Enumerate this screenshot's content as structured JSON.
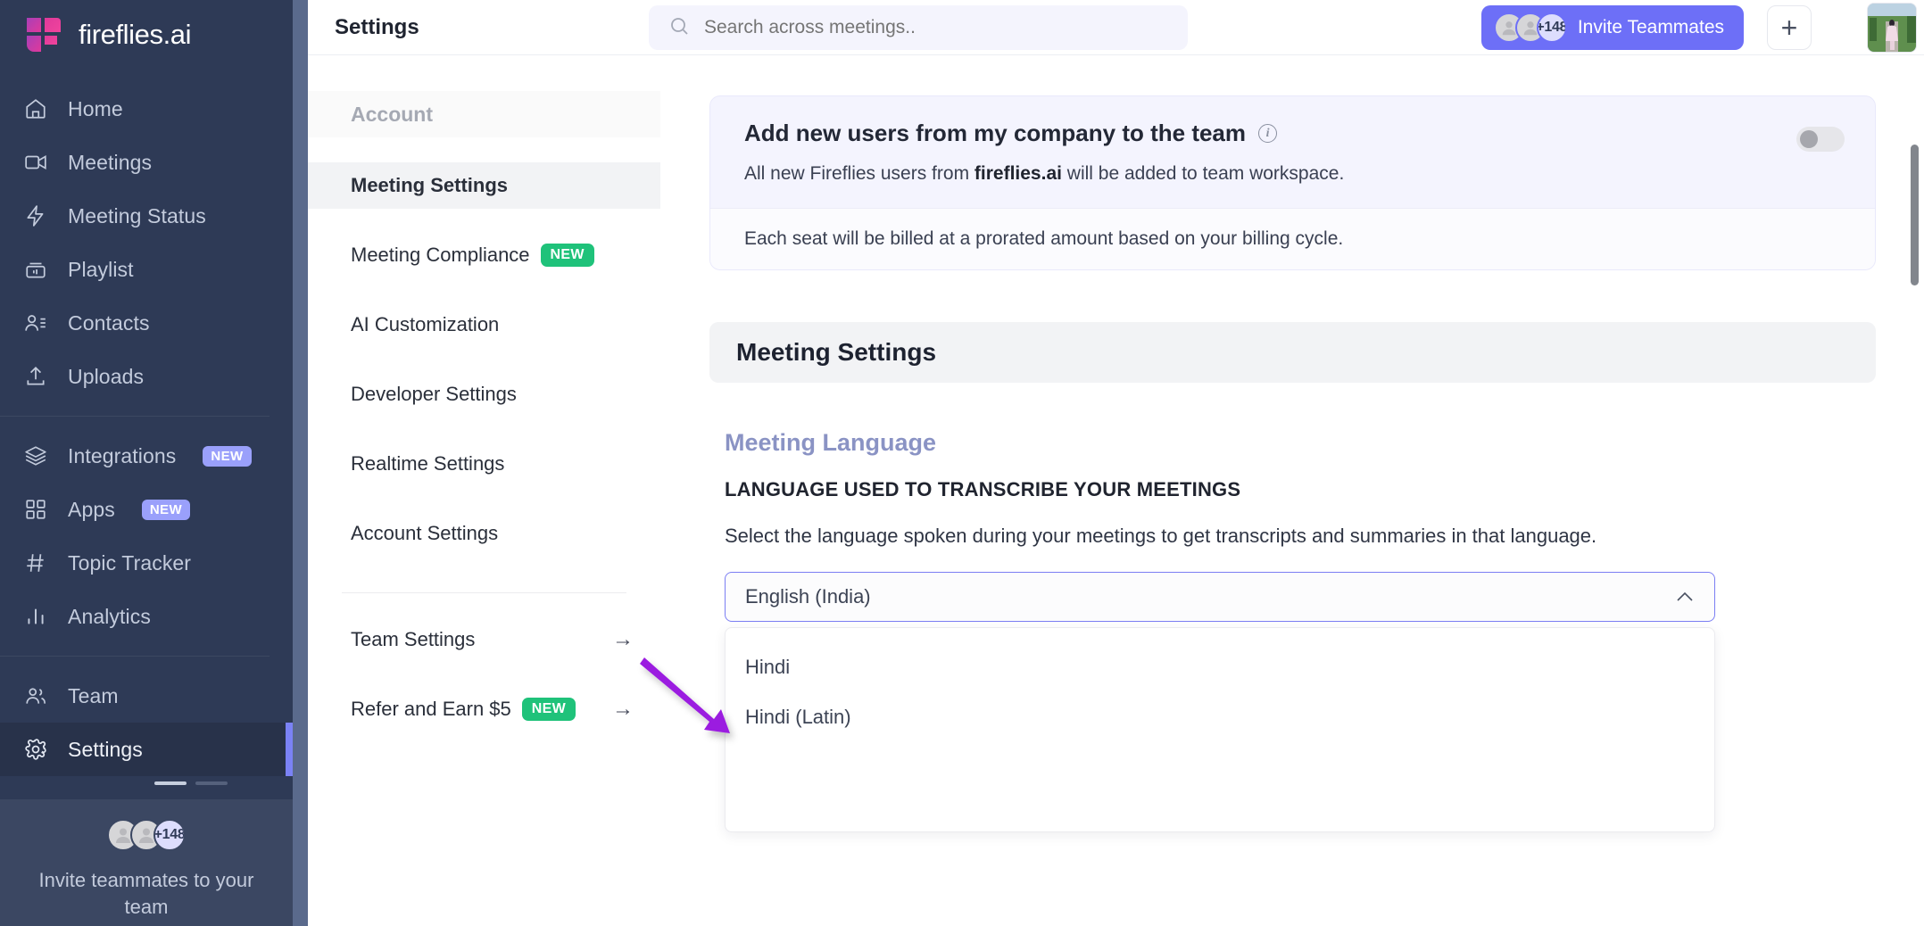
{
  "brand": {
    "name": "fireflies.ai",
    "logo_icon": "fireflies-logo-icon",
    "logo_color": "#e0399b"
  },
  "sidebar": {
    "items": [
      {
        "label": "Home",
        "icon": "home-icon",
        "badge": null,
        "active": false
      },
      {
        "label": "Meetings",
        "icon": "video-camera-icon",
        "badge": null,
        "active": false
      },
      {
        "label": "Meeting Status",
        "icon": "lightning-bolt-icon",
        "badge": null,
        "active": false
      },
      {
        "label": "Playlist",
        "icon": "playlist-icon",
        "badge": null,
        "active": false
      },
      {
        "label": "Contacts",
        "icon": "contacts-icon",
        "badge": null,
        "active": false
      },
      {
        "label": "Uploads",
        "icon": "upload-icon",
        "badge": null,
        "active": false
      }
    ],
    "items_group2": [
      {
        "label": "Integrations",
        "icon": "layers-icon",
        "badge": "NEW",
        "active": false
      },
      {
        "label": "Apps",
        "icon": "grid-icon",
        "badge": "NEW",
        "active": false
      },
      {
        "label": "Topic Tracker",
        "icon": "hash-icon",
        "badge": null,
        "active": false
      },
      {
        "label": "Analytics",
        "icon": "bar-chart-icon",
        "badge": null,
        "active": false
      }
    ],
    "items_group3": [
      {
        "label": "Team",
        "icon": "team-icon",
        "badge": null,
        "active": false
      },
      {
        "label": "Settings",
        "icon": "gear-icon",
        "badge": null,
        "active": true
      }
    ],
    "badge_new_color": "#9aa0fb",
    "invite": {
      "count_badge": "+148",
      "text": "Invite teammates to your team"
    }
  },
  "topbar": {
    "page_title": "Settings",
    "search": {
      "placeholder": "Search across meetings..",
      "value": "",
      "icon": "search-icon"
    },
    "ai_button_icon": "ai-robot-icon",
    "invite_button": {
      "label": "Invite Teammates",
      "count_badge": "+148",
      "color": "#6d6ff7"
    },
    "plus_button_label": "+",
    "user_avatar_icon": "user-avatar-photo"
  },
  "settings_nav": {
    "header": "Account",
    "items": [
      {
        "label": "Meeting Settings",
        "badge": null,
        "arrow": false,
        "active": true
      },
      {
        "label": "Meeting Compliance",
        "badge": "NEW",
        "arrow": false,
        "active": false
      },
      {
        "label": "AI Customization",
        "badge": null,
        "arrow": false,
        "active": false
      },
      {
        "label": "Developer Settings",
        "badge": null,
        "arrow": false,
        "active": false
      },
      {
        "label": "Realtime Settings",
        "badge": null,
        "arrow": false,
        "active": false
      },
      {
        "label": "Account Settings",
        "badge": null,
        "arrow": false,
        "active": false
      }
    ],
    "items_bottom": [
      {
        "label": "Team Settings",
        "badge": null,
        "arrow": true,
        "active": false
      },
      {
        "label": "Refer and Earn $5",
        "badge": "NEW",
        "arrow": true,
        "active": false
      }
    ],
    "badge_new_color": "#1fc27a"
  },
  "main": {
    "add_users_card": {
      "title": "Add new users from my company to the team",
      "info_icon": "info-icon",
      "subtitle_pre": "All new Fireflies users from ",
      "subtitle_bold": "fireflies.ai",
      "subtitle_post": " will be added to team workspace.",
      "footer_note": "Each seat will be billed at a prorated amount based on your billing cycle.",
      "toggle_state": "off"
    },
    "section_title": "Meeting Settings",
    "language": {
      "heading": "Meeting Language",
      "caps_label": "LANGUAGE USED TO TRANSCRIBE YOUR MEETINGS",
      "description": "Select the language spoken during your meetings to get transcripts and summaries in that language.",
      "selected_value": "English (India)",
      "chevron_icon": "chevron-up-icon",
      "dropdown_open": true,
      "options": [
        "Hindi",
        "Hindi (Latin)"
      ]
    }
  },
  "annotation": {
    "arrow_color": "#9b1fe0",
    "points_to": "Hindi"
  }
}
